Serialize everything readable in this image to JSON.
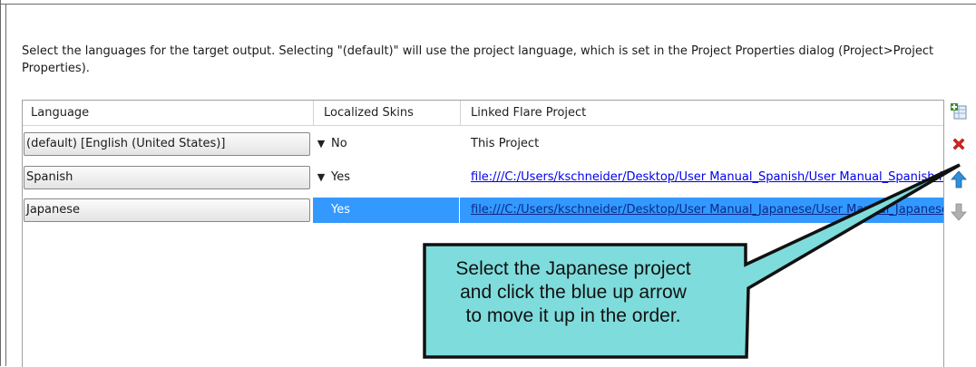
{
  "description": "Select the languages for the target output. Selecting \"(default)\" will use the project language, which is set in the Project Properties dialog (Project>Project Properties).",
  "table": {
    "columns": [
      "Language",
      "Localized Skins",
      "Linked Flare Project"
    ],
    "rows": [
      {
        "language": "(default) [English (United States)]",
        "skins": "No",
        "project": "This Project",
        "is_link": false,
        "selected": false
      },
      {
        "language": "Spanish",
        "skins": "Yes",
        "project": "file:///C:/Users/kschneider/Desktop/User Manual_Spanish/User Manual_Spanish.flprj",
        "is_link": true,
        "selected": false
      },
      {
        "language": "Japanese",
        "skins": "Yes",
        "project": "file:///C:/Users/kschneider/Desktop/User Manual_Japanese/User Manual_Japanese.flprj",
        "is_link": true,
        "selected": true
      }
    ]
  },
  "side_toolbar": [
    {
      "icon": "add-row-icon",
      "color": "#3a8f2c"
    },
    {
      "icon": "delete-icon",
      "color": "#d8261c"
    },
    {
      "icon": "move-up-arrow-icon",
      "color": "#2f8fd8"
    },
    {
      "icon": "move-down-arrow-icon",
      "color": "#a8a8a8"
    }
  ],
  "callout": {
    "lines": [
      "Select the Japanese project",
      "and click the blue up arrow",
      "to move it up in the order."
    ],
    "fill": "#7fdcdc"
  },
  "colors": {
    "selection": "#3399ff",
    "link": "#0000ee"
  }
}
